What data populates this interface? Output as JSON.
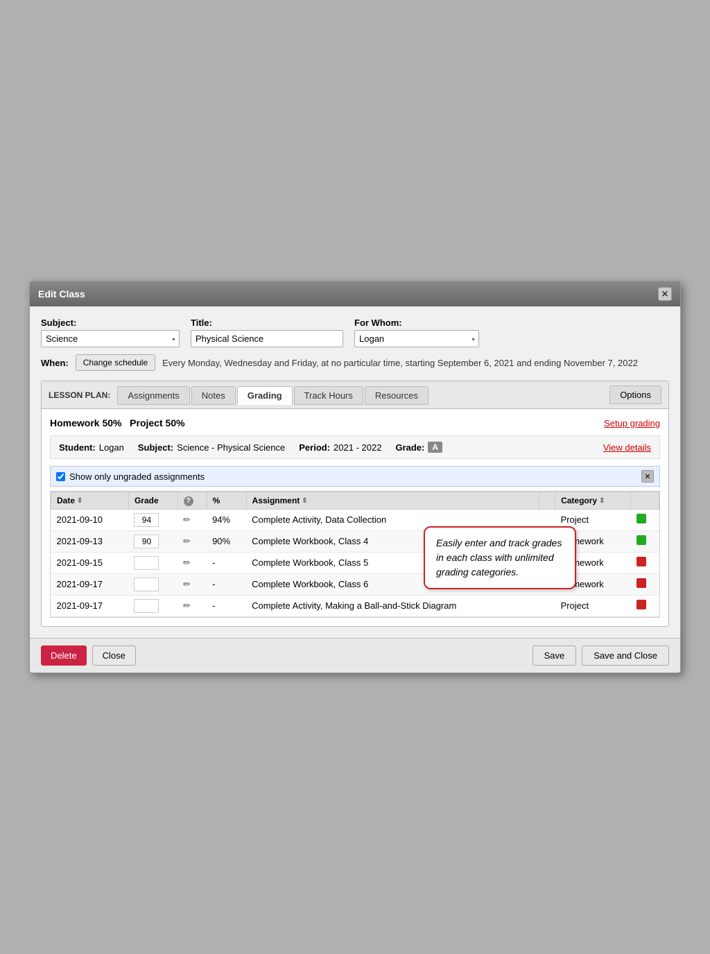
{
  "modal": {
    "title": "Edit Class",
    "close_label": "✕"
  },
  "form": {
    "subject_label": "Subject:",
    "subject_value": "Science",
    "title_label": "Title:",
    "title_value": "Physical Science",
    "forwhom_label": "For Whom:",
    "forwhom_value": "Logan",
    "when_label": "When:",
    "change_schedule_btn": "Change schedule",
    "when_text": "Every Monday, Wednesday and Friday, at no particular time, starting September 6, 2021 and ending November 7, 2022"
  },
  "lesson_plan": {
    "label": "LESSON PLAN:",
    "tabs": [
      {
        "id": "assignments",
        "label": "Assignments",
        "active": false
      },
      {
        "id": "notes",
        "label": "Notes",
        "active": false
      },
      {
        "id": "grading",
        "label": "Grading",
        "active": true
      },
      {
        "id": "track-hours",
        "label": "Track Hours",
        "active": false
      },
      {
        "id": "resources",
        "label": "Resources",
        "active": false
      }
    ],
    "options_tab": "Options"
  },
  "grading": {
    "categories_text": "Homework 50%   Project 50%",
    "setup_grading_link": "Setup grading",
    "student_label": "Student:",
    "student_name": "Logan",
    "subject_label": "Subject:",
    "subject_value": "Science - Physical Science",
    "period_label": "Period:",
    "period_value": "2021 - 2022",
    "grade_label": "Grade:",
    "grade_value": "A",
    "view_details_link": "View details",
    "filter_checkbox_label": "Show only ungraded assignments",
    "filter_checked": true,
    "table": {
      "headers": [
        "Date",
        "Grade",
        "?",
        "%",
        "Assignment",
        "",
        "Category",
        ""
      ],
      "rows": [
        {
          "date": "2021-09-10",
          "grade": "94",
          "percent": "94%",
          "assignment": "Complete Activity, Data Collection",
          "category": "Project",
          "status": "green"
        },
        {
          "date": "2021-09-13",
          "grade": "90",
          "percent": "90%",
          "assignment": "Complete Workbook, Class 4",
          "category": "Homework",
          "status": "green"
        },
        {
          "date": "2021-09-15",
          "grade": "",
          "percent": "-",
          "assignment": "Complete Workbook, Class 5",
          "category": "Homework",
          "status": "red"
        },
        {
          "date": "2021-09-17",
          "grade": "",
          "percent": "-",
          "assignment": "Complete Workbook, Class 6",
          "category": "Homework",
          "status": "red"
        },
        {
          "date": "2021-09-17",
          "grade": "",
          "percent": "-",
          "assignment": "Complete Activity, Making a Ball-and-Stick Diagram",
          "category": "Project",
          "status": "red"
        }
      ]
    },
    "tooltip": {
      "text": "Easily enter and track grades in each class with unlimited grading categories."
    }
  },
  "footer": {
    "delete_label": "Delete",
    "close_label": "Close",
    "save_label": "Save",
    "save_close_label": "Save and Close"
  }
}
